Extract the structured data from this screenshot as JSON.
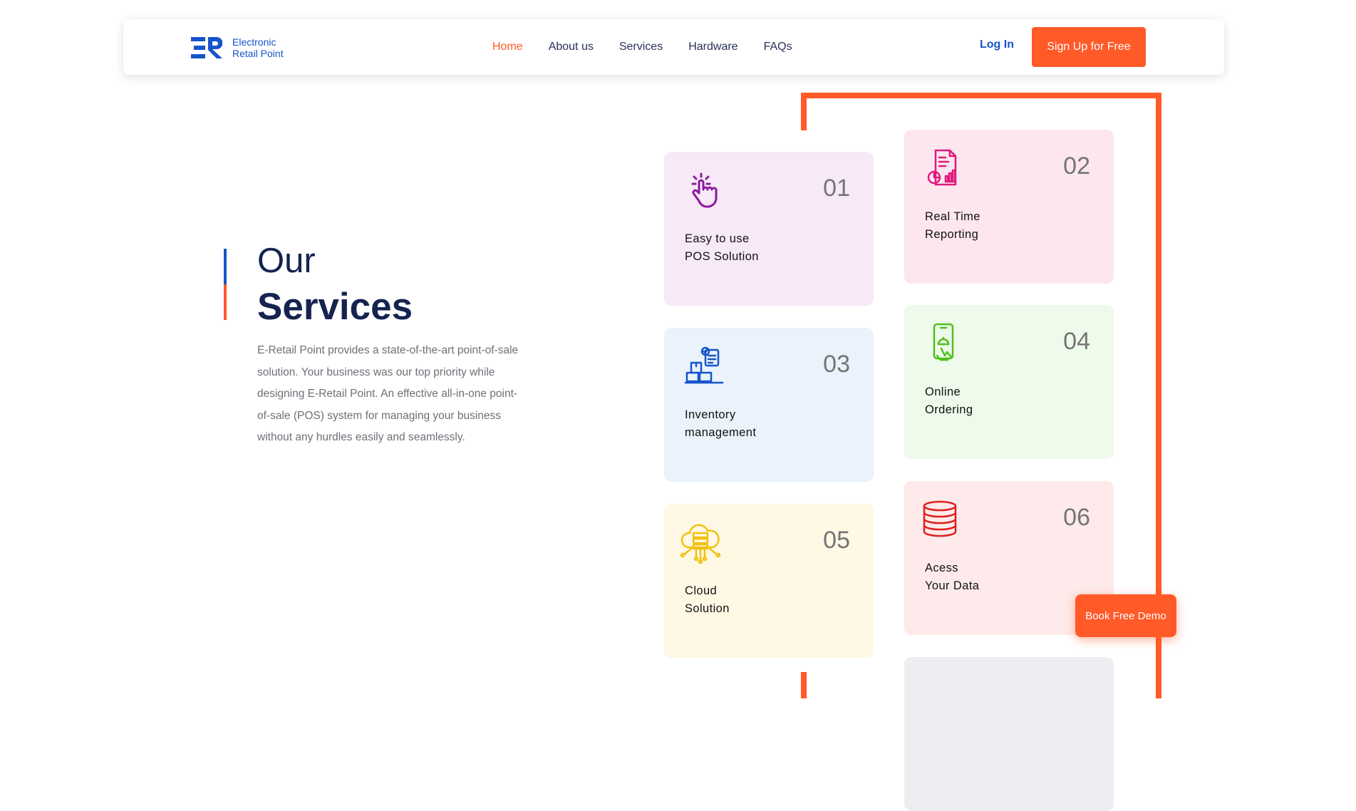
{
  "brand": {
    "line1": "Electronic",
    "line2": "Retail Point",
    "color": "#1654c9"
  },
  "nav": {
    "links": [
      "Home",
      "About us",
      "Services",
      "Hardware",
      "FAQs"
    ],
    "active": "Home",
    "login": "Log In",
    "signup": "Sign Up for Free"
  },
  "hero": {
    "title_line1": "Our",
    "title_line2": "Services",
    "description": "E-Retail Point provides a state-of-the-art point-of-sale solution. Your business was our top priority while designing E-Retail Point. An effective all-in-one point-of-sale (POS) system for managing your business without any hurdles easily and seamlessly."
  },
  "services": [
    {
      "number": "01",
      "label": "Easy to use\nPOS Solution",
      "icon": "tap-hand-icon",
      "color": "#8b1a9e"
    },
    {
      "number": "02",
      "label": "Real Time\nReporting",
      "icon": "report-document-icon",
      "color": "#e0197d"
    },
    {
      "number": "03",
      "label": "Inventory\nmanagement",
      "icon": "inventory-boxes-icon",
      "color": "#1654c9"
    },
    {
      "number": "04",
      "label": "Online\nOrdering",
      "icon": "mobile-order-icon",
      "color": "#4fbf1d"
    },
    {
      "number": "05",
      "label": "Cloud\nSolution",
      "icon": "cloud-server-icon",
      "color": "#f2c00f"
    },
    {
      "number": "06",
      "label": "Acess\nYour Data",
      "icon": "database-icon",
      "color": "#e02020"
    }
  ],
  "demo_button": "Book Free Demo",
  "colors": {
    "accent": "#ff5a28",
    "primary": "#1654c9",
    "heading": "#15234f"
  }
}
